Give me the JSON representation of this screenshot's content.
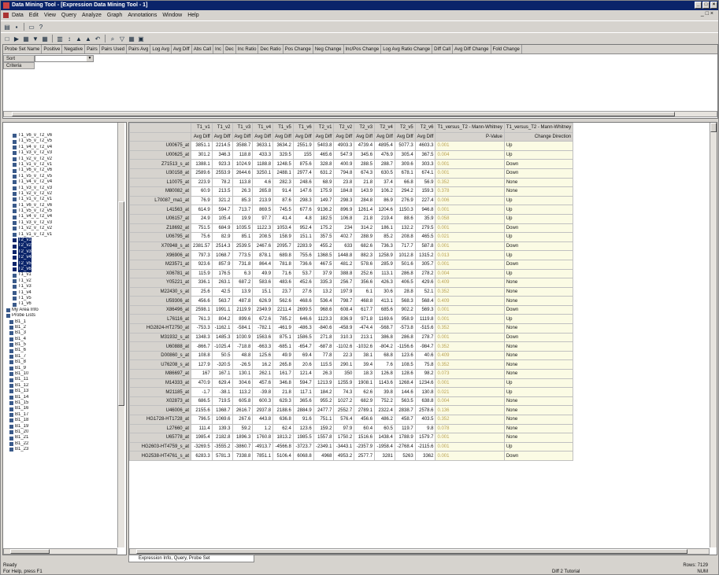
{
  "window": {
    "title": "Data Mining Tool - [Expression Data Mining Tool - 1]"
  },
  "menu": [
    "Data",
    "Edit",
    "View",
    "Query",
    "Analyze",
    "Graph",
    "Annotations",
    "Window",
    "Help"
  ],
  "query": {
    "columns": [
      "Probe Set Name",
      "Positive",
      "Negative",
      "Pairs",
      "Pairs Used",
      "Pairs Avg",
      "Log Avg",
      "Avg Diff",
      "Abs Call",
      "Inc",
      "Dec",
      "Inc Ratio",
      "Dec Ratio",
      "Pos Change",
      "Neg Change",
      "Inc/Pos Change",
      "Log Avg Ratio Change",
      "Diff Call",
      "Avg Diff Change",
      "Fold Change"
    ],
    "rows": [
      "Sort",
      "Criteria"
    ]
  },
  "tree": [
    "T1_v6_v_T2_v6",
    "T1_v5_v_T2_v5",
    "T1_v4_v_T2_v4",
    "T1_v3_v_T2_v3",
    "T1_v2_v_T2_v2",
    "T1_v1_v_T2_v1",
    "T1_v6_v_T2_v6",
    "T1_v5_v_T2_v5",
    "T1_v4_v_T2_v4",
    "T1_v3_v_T2_v3",
    "T1_v2_v_T2_v2",
    "T1_v1_v_T2_v1",
    "T1_v6_v_T2_v6",
    "T1_v5_v_T2_v5",
    "T1_v4_v_T2_v4",
    "T1_v3_v_T2_v3",
    "T1_v2_v_T2_v2",
    "T1_v1_v_T2_v1",
    "T2_v1",
    "T2_v2",
    "T2_v3",
    "T2_v4",
    "T2_v5",
    "T2_v6",
    "T1_v1",
    "T1_v2",
    "T1_v3",
    "T1_v4",
    "T1_v5",
    "T1_v6",
    "My Area Info",
    "Probe Lists",
    "B1_1",
    "B1_2",
    "B1_3",
    "B1_4",
    "B1_5",
    "B1_6",
    "B1_7",
    "B1_8",
    "B1_9",
    "B1_10",
    "B1_11",
    "B1_12",
    "B1_13",
    "B1_14",
    "B1_15",
    "B1_16",
    "B1_17",
    "B1_18",
    "B1_19",
    "B1_20",
    "B1_21",
    "B1_22",
    "B1_23"
  ],
  "grid": {
    "cols": [
      "T1_v1",
      "T1_v2",
      "T1_v3",
      "T1_v4",
      "T1_v5",
      "T1_v6",
      "T2_v1",
      "T2_v2",
      "T2_v3",
      "T2_v4",
      "T2_v5",
      "T2_v6"
    ],
    "sub": "Avg Diff",
    "extra": [
      "T1_versus_T2 - Mann-Whitney",
      "T1_versus_T2 - Mann-Whitney"
    ],
    "extraSub": [
      "P-Value",
      "Change Direction"
    ],
    "rows": [
      [
        "U00675_at",
        "3851.1",
        "2214.5",
        "3588.7",
        "3633.1",
        "3634.2",
        "2551.9",
        "5403.8",
        "4903.3",
        "4739.4",
        "4895.4",
        "5077.3",
        "4603.3",
        "0.001",
        "Up"
      ],
      [
        "U00625_at",
        "301.2",
        "346.3",
        "118.8",
        "433.3",
        "329.5",
        "155",
        "465.6",
        "547.9",
        "345.6",
        "476.9",
        "305.4",
        "367.5",
        "0.004",
        "Up"
      ],
      [
        "Z71513_s_at",
        "1388.1",
        "923.3",
        "1024.9",
        "1188.8",
        "1248.5",
        "875.6",
        "328.8",
        "400.9",
        "288.5",
        "288.7",
        "309.6",
        "303.3",
        "0.001",
        "Down"
      ],
      [
        "U30158_at",
        "2589.6",
        "2553.9",
        "2644.6",
        "3250.1",
        "2488.1",
        "2977.4",
        "631.2",
        "794.8",
        "674.3",
        "630.5",
        "678.1",
        "674.1",
        "0.001",
        "Down"
      ],
      [
        "L10075_at",
        "223.9",
        "78.2",
        "113.8",
        "4.6",
        "282.3",
        "248.6",
        "68.9",
        "23.8",
        "21.8",
        "37.4",
        "66.8",
        "56.9",
        "0.352",
        "None"
      ],
      [
        "M80082_at",
        "60.9",
        "213.5",
        "26.3",
        "265.8",
        "91.4",
        "147.6",
        "175.9",
        "184.8",
        "143.9",
        "106.2",
        "294.2",
        "159.3",
        "0.378",
        "None"
      ],
      [
        "L70087_rna1_at",
        "76.9",
        "321.2",
        "85.3",
        "213.9",
        "87.6",
        "298.3",
        "149.7",
        "298.3",
        "284.8",
        "86.9",
        "276.9",
        "227.4",
        "0.006",
        "Up"
      ],
      [
        "L41563_at",
        "614.9",
        "594.7",
        "713.7",
        "869.5",
        "745.5",
        "677.6",
        "9136.2",
        "896.9",
        "1261.4",
        "1204.6",
        "1150.3",
        "946.8",
        "0.001",
        "Up"
      ],
      [
        "U06157_at",
        "24.9",
        "105.4",
        "19.9",
        "97.7",
        "41.4",
        "4.8",
        "182.5",
        "106.8",
        "21.8",
        "219.4",
        "88.6",
        "35.9",
        "0.058",
        "Up"
      ],
      [
        "Z18692_at",
        "751.5",
        "684.9",
        "1035.5",
        "1122.3",
        "1053.4",
        "952.4",
        "175.2",
        "234",
        "314.2",
        "186.1",
        "132.2",
        "279.5",
        "0.001",
        "Down"
      ],
      [
        "U06795_at",
        "75.6",
        "82.9",
        "85.1",
        "208.5",
        "158.9",
        "151.1",
        "357.5",
        "402.7",
        "288.9",
        "85.2",
        "208.8",
        "465.5",
        "0.021",
        "Up"
      ],
      [
        "X70948_s_at",
        "2381.57",
        "2514.3",
        "2539.5",
        "2467.6",
        "2095.7",
        "2283.9",
        "455.2",
        "633",
        "682.6",
        "736.3",
        "717.7",
        "587.8",
        "0.001",
        "Down"
      ],
      [
        "X96906_at",
        "797.3",
        "1068.7",
        "773.5",
        "878.1",
        "689.8",
        "755.6",
        "1368.5",
        "1448.8",
        "882.3",
        "1258.9",
        "1012.8",
        "1315.2",
        "0.013",
        "Up"
      ],
      [
        "M23571_at",
        "923.6",
        "857.9",
        "731.8",
        "864.4",
        "781.8",
        "736.6",
        "467.5",
        "481.2",
        "578.6",
        "285.9",
        "501.6",
        "305.7",
        "0.001",
        "Down"
      ],
      [
        "X06781_at",
        "115.9",
        "176.5",
        "6.3",
        "49.9",
        "71.6",
        "53.7",
        "37.9",
        "388.8",
        "252.6",
        "113.1",
        "286.8",
        "278.2",
        "0.004",
        "Up"
      ],
      [
        "Y05221_at",
        "336.1",
        "263.1",
        "687.2",
        "583.6",
        "483.6",
        "452.6",
        "335.3",
        "256.7",
        "356.6",
        "426.3",
        "406.5",
        "429.6",
        "0.409",
        "None"
      ],
      [
        "M22430_s_at",
        "25.6",
        "42.5",
        "13.9",
        "15.1",
        "23.7",
        "27.6",
        "13.2",
        "197.9",
        "6.1",
        "30.6",
        "28.8",
        "52.1",
        "0.352",
        "None"
      ],
      [
        "U59306_at",
        "456.6",
        "563.7",
        "487.8",
        "626.9",
        "562.6",
        "468.6",
        "536.4",
        "798.7",
        "468.8",
        "413.1",
        "568.3",
        "568.4",
        "0.409",
        "None"
      ],
      [
        "X86496_at",
        "2598.1",
        "1991.1",
        "2119.9",
        "2349.9",
        "2211.4",
        "2699.5",
        "968.6",
        "608.4",
        "617.7",
        "685.6",
        "902.2",
        "569.3",
        "0.001",
        "Down"
      ],
      [
        "L76116_at",
        "761.3",
        "804.2",
        "899.6",
        "672.6",
        "785.2",
        "646.6",
        "1123.3",
        "836.9",
        "971.8",
        "1169.6",
        "958.9",
        "1119.8",
        "0.001",
        "Up"
      ],
      [
        "HG2824-HT2750_at",
        "-753.3",
        "-1162.1",
        "-584.1",
        "-782.1",
        "-461.9",
        "-486.3",
        "-840.6",
        "-458.9",
        "-474.4",
        "-568.7",
        "-573.8",
        "-515.6",
        "0.352",
        "None"
      ],
      [
        "M31932_s_at",
        "1348.3",
        "1485.3",
        "1030.9",
        "1563.6",
        "875.1",
        "1586.5",
        "271.8",
        "310.3",
        "213.1",
        "386.8",
        "286.8",
        "278.7",
        "0.001",
        "Down"
      ],
      [
        "U60888_at",
        "-866.7",
        "-1025.4",
        "-718.8",
        "-663.3",
        "-685.1",
        "-654.7",
        "-687.8",
        "-1102.6",
        "-1032.6",
        "-804.2",
        "-1156.6",
        "-984.7",
        "0.352",
        "None"
      ],
      [
        "D00860_s_at",
        "108.8",
        "50.5",
        "48.8",
        "125.6",
        "49.9",
        "69.4",
        "77.8",
        "22.3",
        "38.1",
        "68.8",
        "123.6",
        "40.6",
        "0.409",
        "None"
      ],
      [
        "U76208_s_at",
        "127.9",
        "-320.5",
        "-26.5",
        "16.2",
        "265.8",
        "20.6",
        "115.5",
        "290.1",
        "39.4",
        "7.6",
        "108.5",
        "75.8",
        "0.352",
        "None"
      ],
      [
        "M86697_at",
        "167",
        "167.1",
        "130.1",
        "262.1",
        "161.7",
        "121.4",
        "26.3",
        "350",
        "18.3",
        "126.8",
        "128.6",
        "98.2",
        "0.073",
        "None"
      ],
      [
        "M14333_at",
        "470.9",
        "629.4",
        "304.6",
        "457.6",
        "346.8",
        "594.7",
        "1213.9",
        "1255.9",
        "1908.1",
        "1143.6",
        "1268.4",
        "1234.6",
        "0.001",
        "Up"
      ],
      [
        "M21185_at",
        "-1.7",
        "-38.1",
        "113.2",
        "-39.8",
        "21.8",
        "117.1",
        "184.2",
        "74.3",
        "62.6",
        "39.8",
        "144.6",
        "130.8",
        "0.021",
        "Up"
      ],
      [
        "X02873_at",
        "686.5",
        "719.5",
        "605.8",
        "600.3",
        "629.3",
        "365.6",
        "955.2",
        "1027.2",
        "682.9",
        "752.2",
        "563.5",
        "638.8",
        "0.004",
        "None"
      ],
      [
        "U46006_at",
        "2155.6",
        "1368.7",
        "2616.7",
        "2937.8",
        "2188.6",
        "2884.9",
        "2477.7",
        "2552.7",
        "2789.1",
        "2322.4",
        "2838.7",
        "2578.6",
        "0.136",
        "None"
      ],
      [
        "HG1728-HT1728_at",
        "796.5",
        "1069.6",
        "267.6",
        "443.8",
        "636.8",
        "91.6",
        "751.1",
        "576.4",
        "456.6",
        "486.2",
        "458.7",
        "403.5",
        "0.352",
        "None"
      ],
      [
        "L27660_at",
        "111.4",
        "139.3",
        "59.2",
        "1.2",
        "62.4",
        "123.6",
        "159.2",
        "97.9",
        "60.4",
        "60.5",
        "119.7",
        "9.8",
        "0.078",
        "None"
      ],
      [
        "U65778_at",
        "1985.4",
        "2182.8",
        "1896.3",
        "1760.8",
        "1813.2",
        "1985.5",
        "1557.8",
        "1750.2",
        "1516.6",
        "1438.4",
        "1788.9",
        "1579.7",
        "0.001",
        "None"
      ],
      [
        "HG2603-HT4759_s_at",
        "-3269.5",
        "-3555.2",
        "-3860.7",
        "-4913.7",
        "-4566.8",
        "-3723.7",
        "-2349.1",
        "-3443.1",
        "-2357.9",
        "-1958.4",
        "-2768.4",
        "-2115.6",
        "0.001",
        "Up"
      ],
      [
        "HG2538-HT4761_s_at",
        "6283.3",
        "5781.3",
        "7338.8",
        "7851.1",
        "5106.4",
        "6068.8",
        "4968",
        "4953.2",
        "2577.7",
        "3281",
        "5263",
        "3362",
        "0.001",
        "Down"
      ]
    ]
  },
  "tabs": "Expression Info, Query, Probe Set",
  "status": {
    "left": "Ready",
    "help": "For Help, press F1",
    "rows": "Rows: 7129",
    "file": "Diff 2 Tutorial",
    "num": "NUM"
  }
}
